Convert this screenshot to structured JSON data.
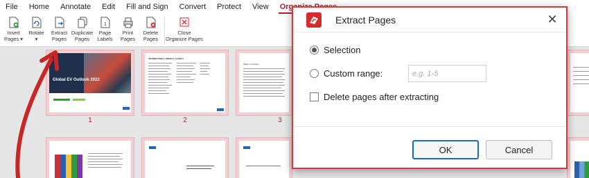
{
  "menubar": {
    "items": [
      "File",
      "Home",
      "Annotate",
      "Edit",
      "Fill and Sign",
      "Convert",
      "Protect",
      "View",
      "Organize Pages"
    ],
    "active": "Organize Pages"
  },
  "ribbon": {
    "insert": "Insert\nPages ▾",
    "rotate": "Rotate\n▾",
    "extract": "Extract\nPages",
    "duplicate": "Duplicate\nPages",
    "labels": "Page\nLabels",
    "print": "Print\nPages",
    "delete": "Delete\nPages",
    "close": "Close\nOrganize Pages"
  },
  "thumbs": {
    "page1_title": "Global EV Outlook 2022",
    "page2_header": "INTERNATIONAL ENERGY AGENCY",
    "page3_header": "Table of contents",
    "page_numbers": [
      "1",
      "2",
      "3"
    ]
  },
  "dialog": {
    "title": "Extract Pages",
    "selection_label": "Selection",
    "custom_range_label": "Custom range:",
    "range_placeholder": "e.g. 1-5",
    "delete_after_label": "Delete pages after extracting",
    "ok_label": "OK",
    "cancel_label": "Cancel",
    "selection_checked": true,
    "delete_after_checked": false
  },
  "colors": {
    "accent": "#b3202a",
    "dialog_border": "#d23a3a",
    "ok_border": "#1a68c8",
    "thumb_selected": "#f3cfd1",
    "arrow": "#c62828"
  }
}
